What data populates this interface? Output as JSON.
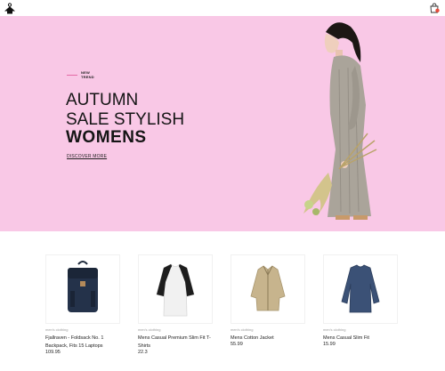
{
  "header": {
    "logo_icon": "hanger-logo-icon",
    "cart_icon": "shopping-bag-icon",
    "cart_badge_color": "#e74c3c"
  },
  "hero": {
    "eyebrow": "NEW\nTREND",
    "line1": "AUTUMN",
    "line2": "SALE STYLISH",
    "line3": "WOMENS",
    "cta": "DISCOVER MORE",
    "background_color": "#f9c8e6",
    "accent_color": "#e46aa6"
  },
  "products": [
    {
      "category": "men's clothing",
      "title": "Fjallraven - Foldsack No. 1 Backpack, Fits 15 Laptops",
      "price": "109.95",
      "image_icon": "backpack-icon"
    },
    {
      "category": "men's clothing",
      "title": "Mens Casual Premium Slim Fit T-Shirts",
      "price": "22.3",
      "image_icon": "tshirt-icon"
    },
    {
      "category": "men's clothing",
      "title": "Mens Cotton Jacket",
      "price": "55.99",
      "image_icon": "jacket-icon"
    },
    {
      "category": "men's clothing",
      "title": "Mens Casual Slim Fit",
      "price": "15.99",
      "image_icon": "longsleeve-shirt-icon"
    }
  ]
}
